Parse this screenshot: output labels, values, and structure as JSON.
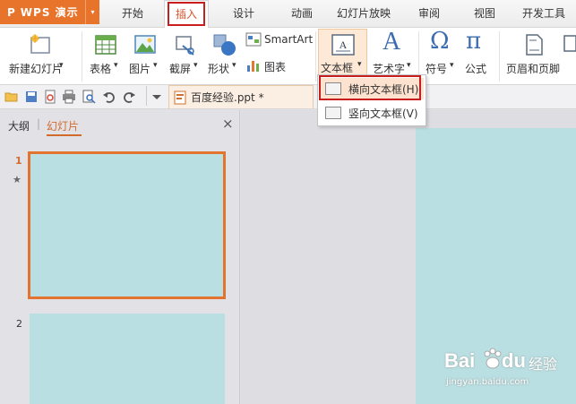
{
  "app": {
    "logo": "P",
    "title": "WPS 演示",
    "menu_arrow": "▾"
  },
  "tabs": [
    "开始",
    "插入",
    "设计",
    "动画",
    "幻灯片放映",
    "审阅",
    "视图",
    "开发工具"
  ],
  "active_tab": "插入",
  "ribbon": {
    "new_slide": "新建幻灯片",
    "table": "表格",
    "picture": "图片",
    "screenshot": "截屏",
    "shapes": "形状",
    "smartart": "SmartArt",
    "chart": "图表",
    "textbox": "文本框",
    "wordart": "艺术字",
    "symbol": "符号",
    "equation": "公式",
    "header_footer": "页眉和页脚",
    "arrow": "▾"
  },
  "document": {
    "tab_title": "百度经验.ppt *"
  },
  "left_panel": {
    "tab_outline": "大纲",
    "tab_slides": "幻灯片",
    "sep": "|",
    "close": "×",
    "slide1_num": "1",
    "slide2_num": "2",
    "star": "★"
  },
  "textbox_menu": {
    "horizontal": "横向文本框(H)",
    "vertical": "竖向文本框(V)"
  },
  "watermark": {
    "brand": "Bai",
    "brand2": "du",
    "cn": "经验",
    "url": "jingyan.baidu.com"
  },
  "colors": {
    "accent": "#e8742b",
    "highlight": "#c81e1e",
    "slide": "#b9dfe2"
  }
}
